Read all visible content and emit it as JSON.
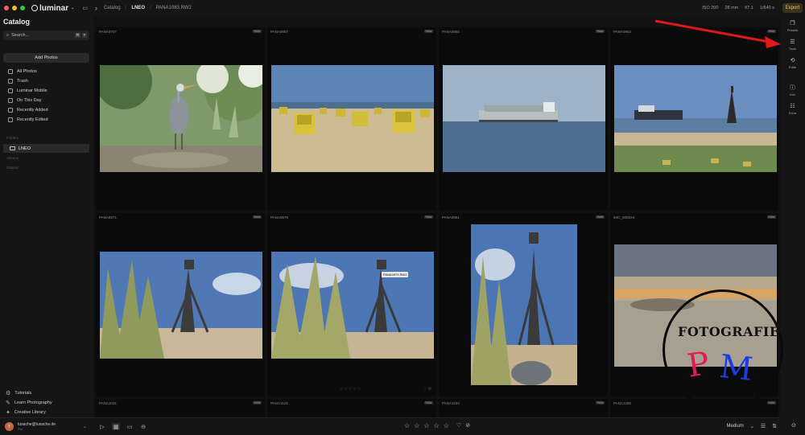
{
  "topbar": {
    "app_name": "luminar",
    "crumbs": [
      "Catalog",
      "LNEO",
      "PANA1083.RW2"
    ],
    "meta": [
      "ISO 200",
      "28 mm",
      "f/7.1",
      "1/640 s"
    ],
    "export_label": "Export"
  },
  "sidebar": {
    "title": "Catalog",
    "search_placeholder": "Search...",
    "search_keys": [
      "⌘",
      "F"
    ],
    "add_photos": "Add Photos",
    "items": [
      {
        "label": "All Photos",
        "icon": "photos-icon"
      },
      {
        "label": "Trash",
        "icon": "trash-icon"
      },
      {
        "label": "Luminar Mobile",
        "icon": "mobile-icon"
      },
      {
        "label": "On This Day",
        "icon": "calendar-icon"
      },
      {
        "label": "Recently Added",
        "icon": "clock-icon"
      },
      {
        "label": "Recently Edited",
        "icon": "edit-icon"
      }
    ],
    "sections": {
      "folders": "Folders",
      "albums": "Albums",
      "shared": "Shared"
    },
    "active_folder": "LNEO",
    "bottom_items": [
      {
        "label": "Tutorials",
        "icon": "gear-icon"
      },
      {
        "label": "Learn Photography",
        "icon": "book-icon"
      },
      {
        "label": "Creative Library",
        "icon": "library-icon"
      }
    ],
    "account": {
      "initial": "T",
      "email": "tusache@tusache.de",
      "plan": "Pro"
    }
  },
  "grid": {
    "raw_label": "RAW",
    "photos": [
      {
        "name": "PANA0707",
        "scene": "heron"
      },
      {
        "name": "PANA0957",
        "scene": "beachchairs"
      },
      {
        "name": "PANA0866",
        "scene": "ship"
      },
      {
        "name": "PANA0903",
        "scene": "tower-ship"
      },
      {
        "name": "PANA0971",
        "scene": "tower-grass"
      },
      {
        "name": "PANA0979",
        "scene": "tower-grass2"
      },
      {
        "name": "PANA0981",
        "scene": "tower-portrait"
      },
      {
        "name": "IMG_0005X4",
        "scene": "blurred-beach"
      },
      {
        "name": "PANA1031",
        "scene": "none"
      },
      {
        "name": "PANA1124",
        "scene": "none"
      },
      {
        "name": "PANA1153",
        "scene": "none"
      },
      {
        "name": "PANA1265",
        "scene": "none"
      }
    ],
    "tooltip": "PANA0979.RW2",
    "cell_stars": "☆☆☆☆☆",
    "cell_heart": "♡ ⊘"
  },
  "right_panel": {
    "items": [
      {
        "label": "Presets",
        "glyph": "❐"
      },
      {
        "label": "Tools",
        "glyph": "☰"
      },
      {
        "label": "Edits",
        "glyph": "⟲"
      },
      {
        "label": "Info",
        "glyph": "ⓘ"
      },
      {
        "label": "Extra",
        "glyph": "☷"
      }
    ]
  },
  "bottombar": {
    "stars": [
      "☆",
      "☆",
      "☆",
      "☆",
      "☆"
    ],
    "hearts": [
      "♡",
      "⊘"
    ],
    "size_label": "Medium",
    "size_chevron": "⌄"
  },
  "overlay": {
    "stamp_text": "FOTOGRAFIE",
    "stamp_p": "P",
    "stamp_m": "M",
    "arrow_color": "#e01818"
  }
}
